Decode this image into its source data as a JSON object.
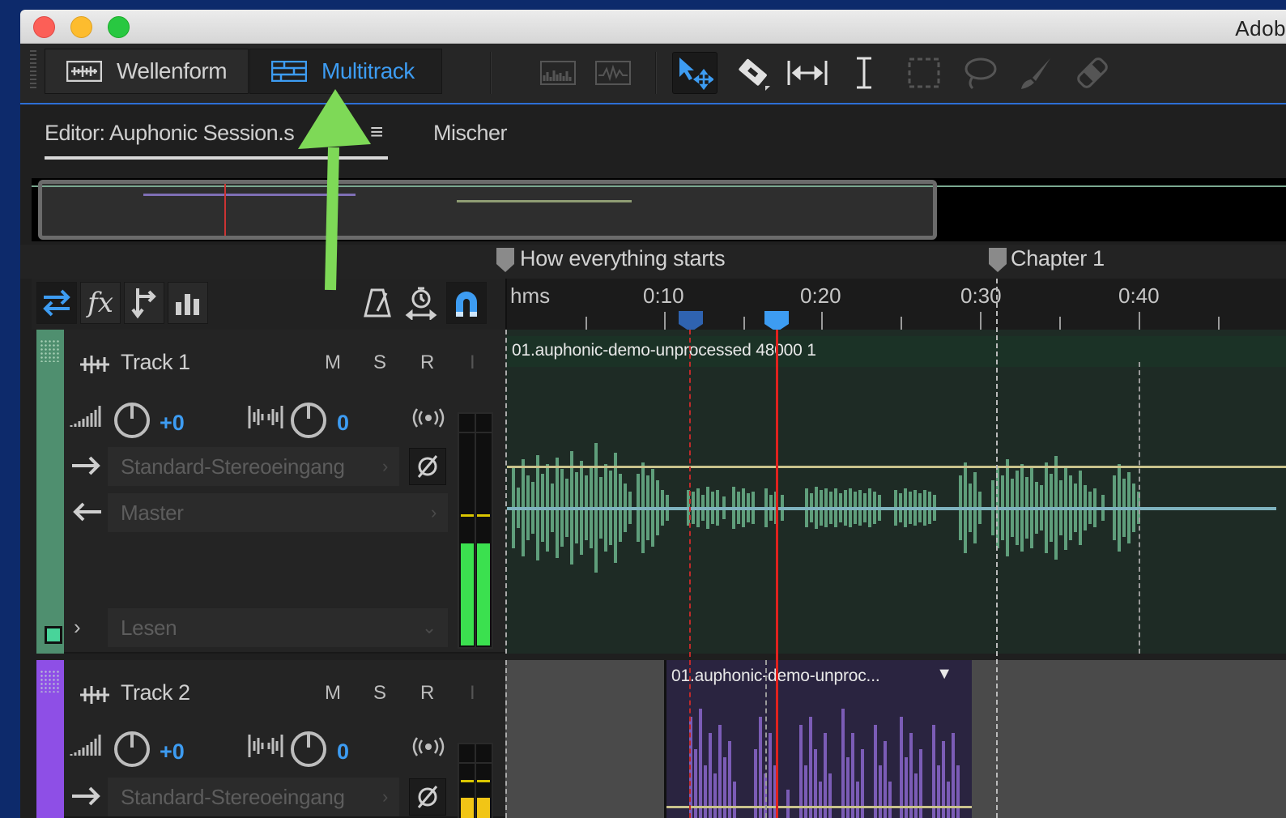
{
  "window": {
    "app_title": "Adob"
  },
  "toolbar": {
    "mode_waveform_label": "Wellenform",
    "mode_multitrack_label": "Multitrack",
    "accent_color": "#3d9cf2"
  },
  "editor": {
    "editor_tab_label": "Editor: Auphonic Session.s",
    "mixer_tab_label": "Mischer"
  },
  "markers": [
    {
      "label": "How everything starts"
    },
    {
      "label": "Chapter 1"
    }
  ],
  "ruler": {
    "unit_label": "hms",
    "labels": [
      "0:10",
      "0:20",
      "0:30",
      "0:40"
    ]
  },
  "controls": {
    "fx_label": "fx"
  },
  "tracks": [
    {
      "name": "Track 1",
      "mute": "M",
      "solo": "S",
      "record": "R",
      "input_monitor": "I",
      "volume": "+0",
      "pan": "0",
      "input": "Standard-Stereoeingang",
      "output": "Master",
      "automation": "Lesen",
      "clip_label": "01.auphonic-demo-unprocessed 48000 1",
      "color": "#4f8f6f"
    },
    {
      "name": "Track 2",
      "mute": "M",
      "solo": "S",
      "record": "R",
      "input_monitor": "I",
      "volume": "+0",
      "pan": "0",
      "input": "Standard-Stereoeingang",
      "clip_label": "01.auphonic-demo-unproc...",
      "color": "#8e4fe6"
    }
  ]
}
